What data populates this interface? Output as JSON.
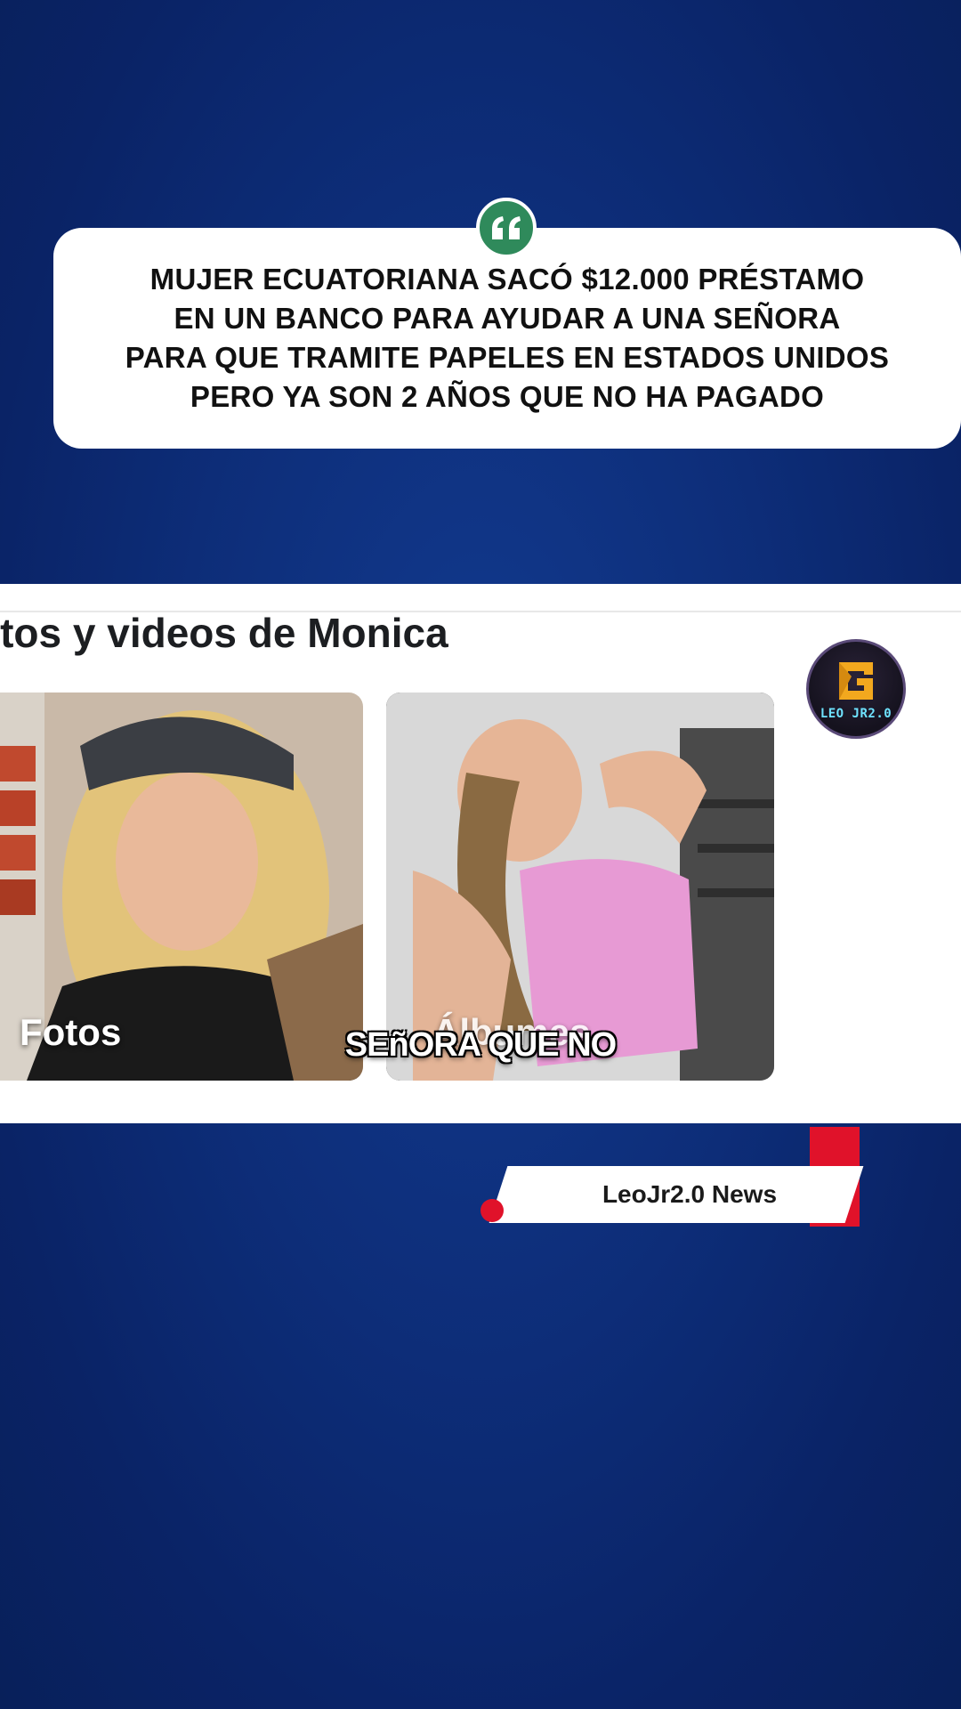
{
  "headline": {
    "text": "MUJER ECUATORIANA SACÓ $12.000 PRÉSTAMO\nEN UN BANCO PARA AYUDAR A UNA SEÑORA\nPARA QUE TRAMITE PAPELES EN ESTADOS UNIDOS\nPERO YA SON 2 AÑOS QUE NO HA PAGADO",
    "quote_icon": "quote-mark-icon"
  },
  "screenshot": {
    "title": "otos y videos de Monica",
    "tiles": [
      {
        "label": "Fotos"
      },
      {
        "label": "Álbumes"
      }
    ]
  },
  "logo": {
    "text": "LEO JR2.0",
    "icon": "leojr-logo-icon"
  },
  "caption": {
    "text": "SEñORA QUE NO"
  },
  "lower_third": {
    "text": "LeoJr2.0 News"
  },
  "colors": {
    "background": "#0d2d78",
    "quote_badge": "#2f8a5b",
    "accent_red": "#e0122a",
    "logo_glow": "#6fe3ff"
  }
}
